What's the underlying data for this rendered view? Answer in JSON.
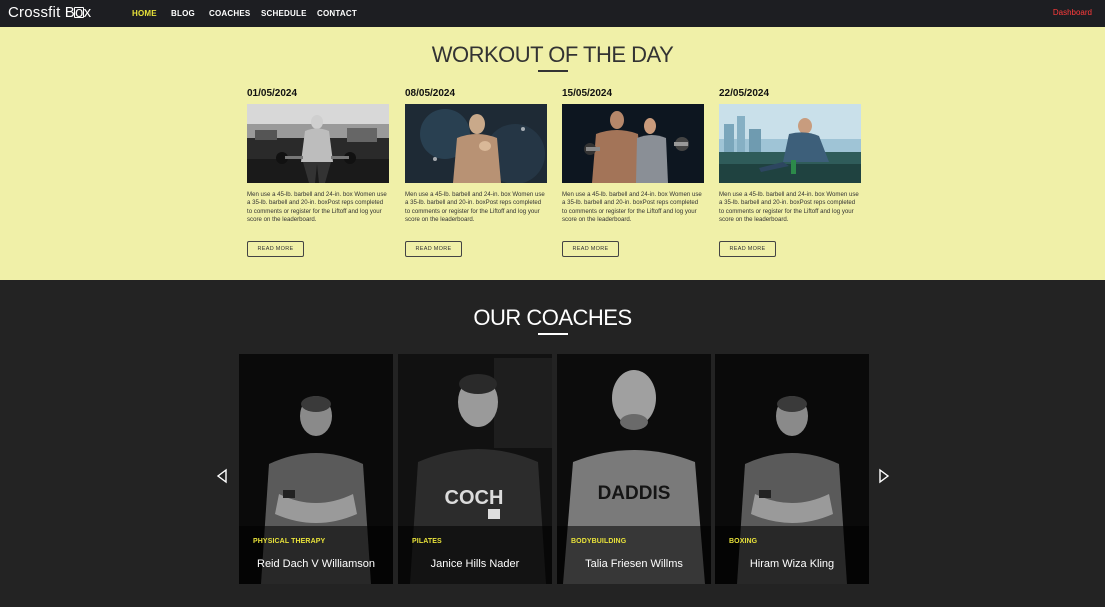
{
  "nav": {
    "logo_prefix": "Crossfit B",
    "logo_mid": "o",
    "logo_suffix": "x",
    "links": [
      "HOME",
      "BLOG",
      "COACHES",
      "SCHEDULE",
      "CONTACT"
    ],
    "dashboard": "Dashboard"
  },
  "wod": {
    "title": "WORKOUT OF THE DAY",
    "cards": [
      {
        "date": "01/05/2024",
        "desc": "Men use a 45-lb. barbell and 24-in. box Women use a 35-lb. barbell and 20-in. boxPost reps completed to comments or register for the Liftoff and log your score on the leaderboard.",
        "button": "READ MORE"
      },
      {
        "date": "08/05/2024",
        "desc": "Men use a 45-lb. barbell and 24-in. box Women use a 35-lb. barbell and 20-in. boxPost reps completed to comments or register for the Liftoff and log your score on the leaderboard.",
        "button": "READ MORE"
      },
      {
        "date": "15/05/2024",
        "desc": "Men use a 45-lb. barbell and 24-in. box Women use a 35-lb. barbell and 20-in. boxPost reps completed to comments or register for the Liftoff and log your score on the leaderboard.",
        "button": "READ MORE"
      },
      {
        "date": "22/05/2024",
        "desc": "Men use a 45-lb. barbell and 24-in. box Women use a 35-lb. barbell and 20-in. boxPost reps completed to comments or register for the Liftoff and log your score on the leaderboard.",
        "button": "READ MORE"
      }
    ]
  },
  "coaches": {
    "title": "OUR COACHES",
    "items": [
      {
        "specialty": "PHYSICAL THERAPY",
        "name": "Reid Dach V Williamson"
      },
      {
        "specialty": "PILATES",
        "name": "Janice Hills Nader"
      },
      {
        "specialty": "BODYBUILDING",
        "name": "Talia Friesen Willms"
      },
      {
        "specialty": "BOXING",
        "name": "Hiram Wiza Kling"
      }
    ],
    "shirt_texts": [
      "COCH",
      "DADDIS"
    ]
  },
  "colors": {
    "navbar_bg": "#1d1e22",
    "accent_yellow": "#e8e23a",
    "wod_bg": "#f0f0a8",
    "dashboard_red": "#ff3b3b",
    "dark_bg": "#232323"
  },
  "icons": {
    "prev": "chevron-left-icon",
    "next": "chevron-right-icon"
  }
}
